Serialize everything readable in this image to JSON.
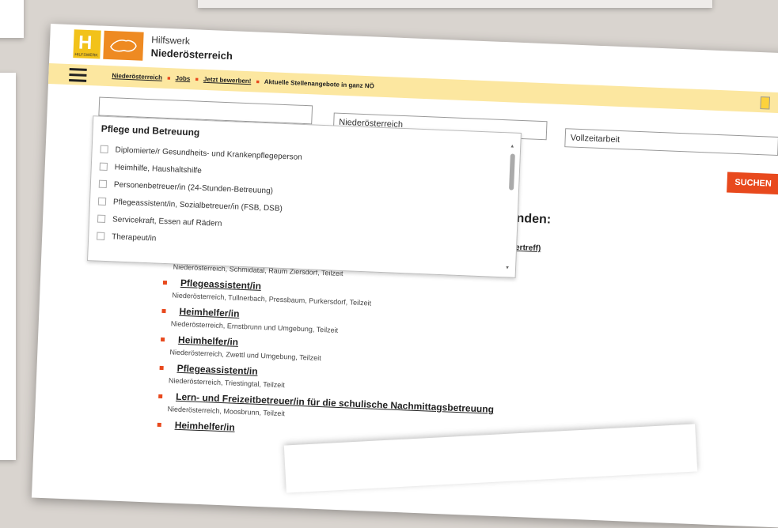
{
  "header": {
    "logo_letter": "H",
    "logo_sub": "HILFSWERK",
    "brand_line1": "Hilfswerk",
    "brand_line2": "Niederösterreich"
  },
  "breadcrumbs": [
    "Niederösterreich",
    "Jobs",
    "Jetzt bewerben!"
  ],
  "breadcrumb_current": "Aktuelle Stellenangebote in ganz NÖ",
  "search": {
    "keyword_value": "",
    "region_value": "Niederösterreich",
    "employment_value": "Vollzeitarbeit",
    "button_label": "SUCHEN"
  },
  "dropdown": {
    "title": "Pflege und Betreuung",
    "options": [
      "Diplomierte/r Gesundheits- und Krankenpflegeperson",
      "Heimhilfe, Haushaltshilfe",
      "Personenbetreuer/in (24-Stunden-Betreuung)",
      "Pflegeassistent/in, Sozialbetreuer/in (FSB, DSB)",
      "Servicekraft, Essen auf Rädern",
      "Therapeut/in"
    ]
  },
  "partial_heading": "nden:",
  "partial_link": "ertreff)",
  "results": {
    "first_location": "Niederösterreich, Schmidatal, Raum Ziersdorf, Teilzeit",
    "jobs": [
      {
        "title": "Pflegeassistent/in",
        "location": "Niederösterreich, Tullnerbach, Pressbaum, Purkersdorf, Teilzeit"
      },
      {
        "title": "Heimhelfer/in",
        "location": "Niederösterreich, Ernstbrunn und Umgebung, Teilzeit"
      },
      {
        "title": "Heimhelfer/in",
        "location": "Niederösterreich, Zwettl und Umgebung, Teilzeit"
      },
      {
        "title": "Pflegeassistent/in",
        "location": "Niederösterreich, Triestingtal, Teilzeit"
      },
      {
        "title": "Lern- und Freizeitbetreuer/in für die schulische Nachmittagsbetreuung",
        "location": "Niederösterreich, Moosbrunn, Teilzeit"
      },
      {
        "title": "Heimhelfer/in",
        "location": ""
      }
    ]
  },
  "colors": {
    "accent": "#e8491d",
    "nav_bg": "#fce7a0",
    "logo_yellow": "#f2c21a",
    "logo_orange": "#ee8a22"
  }
}
